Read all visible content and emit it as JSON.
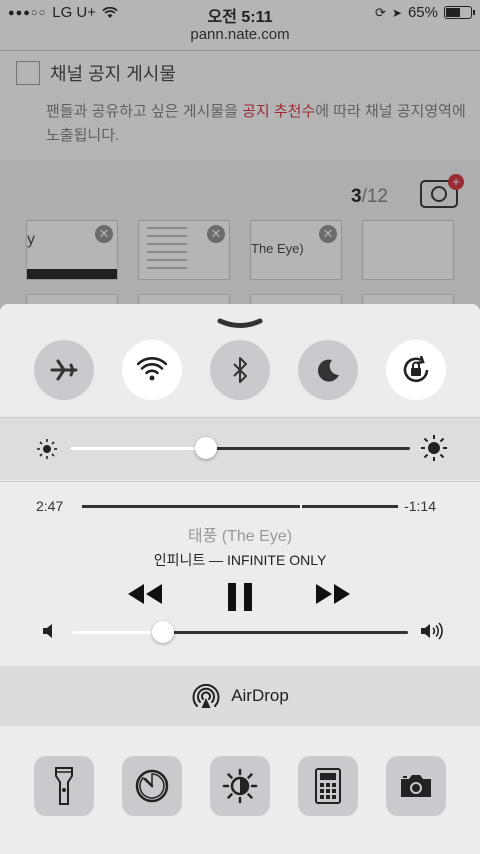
{
  "status": {
    "carrier": "LG U+",
    "time": "오전 5:11",
    "battery": "65%",
    "battery_level": 0.65
  },
  "browser": {
    "url": "pann.nate.com"
  },
  "page": {
    "checkbox_label": "채널 공지 게시물",
    "desc_pre": "팬들과 공유하고 싶은 게시물을 ",
    "desc_highlight": "공지 추천수",
    "desc_post": "에 따라 채널 공지영역에 노출됩니다.",
    "count_current": "3",
    "count_total": "/12",
    "plus": "+",
    "thumb1_text": "y",
    "thumb3_text": "The Eye)",
    "remove": "✕"
  },
  "control_center": {
    "toggles": [
      {
        "name": "airplane-mode",
        "on": false
      },
      {
        "name": "wifi",
        "on": true
      },
      {
        "name": "bluetooth",
        "on": false
      },
      {
        "name": "do-not-disturb",
        "on": false
      },
      {
        "name": "rotation-lock",
        "on": true
      }
    ],
    "brightness": 0.4,
    "music": {
      "elapsed": "2:47",
      "remaining": "-1:14",
      "progress": 0.69,
      "song": "태풍 (The Eye)",
      "artist": "인피니트 — INFINITE ONLY",
      "volume": 0.27
    },
    "airdrop_label": "AirDrop",
    "quick_actions": [
      "flashlight",
      "timer",
      "night-shift",
      "calculator",
      "camera"
    ]
  }
}
